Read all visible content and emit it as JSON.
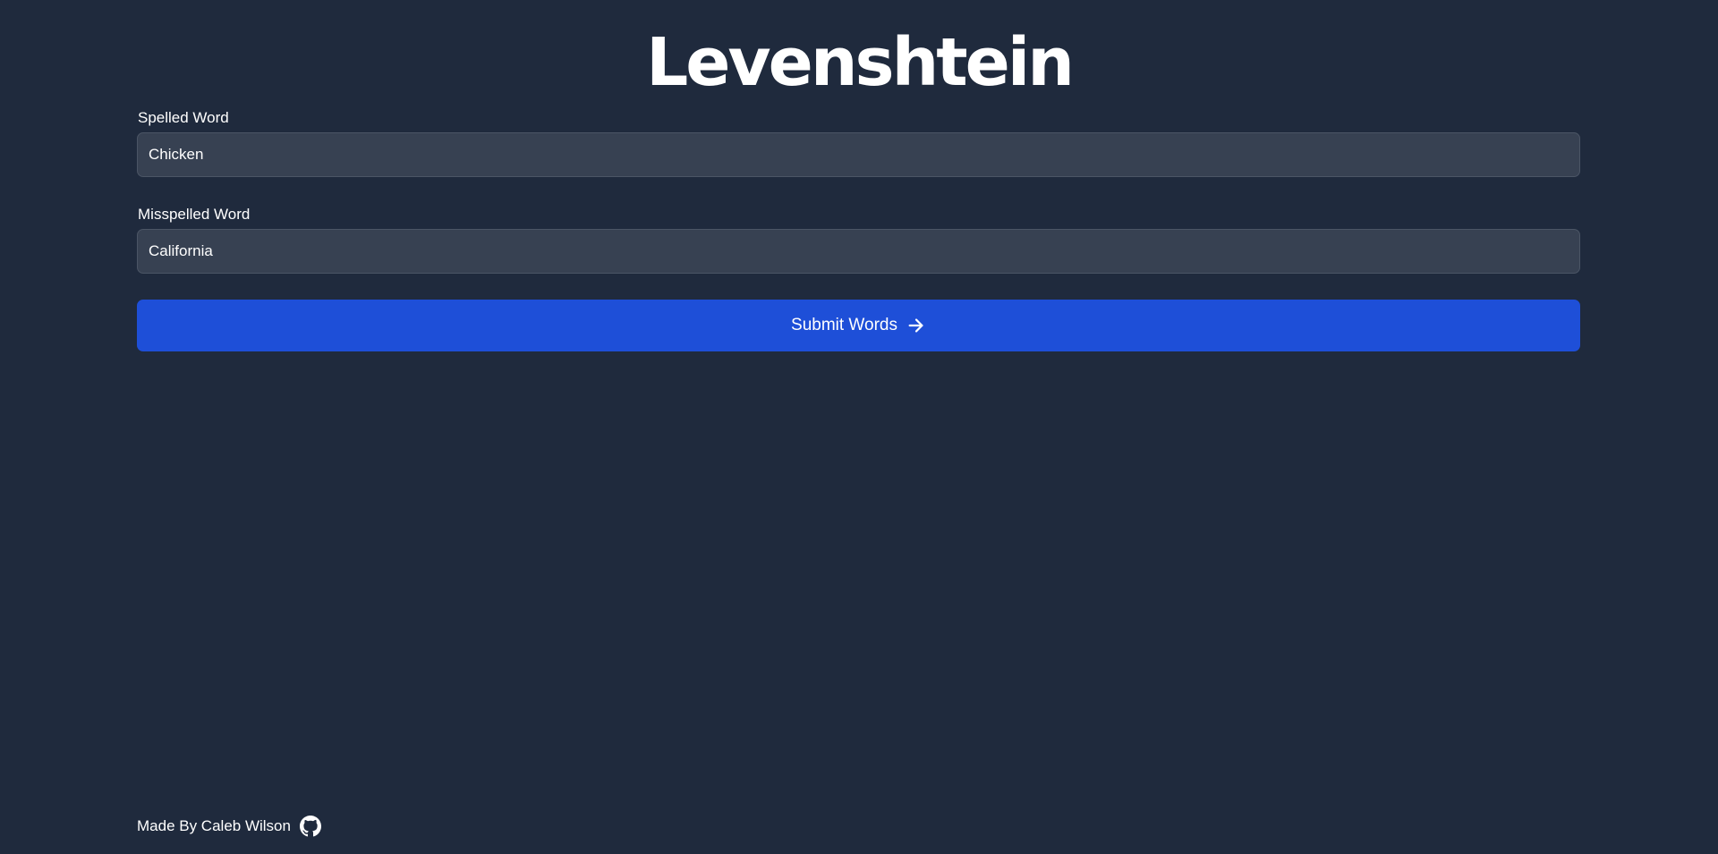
{
  "header": {
    "title": "Levenshtein"
  },
  "form": {
    "spelled": {
      "label": "Spelled Word",
      "value": "Chicken"
    },
    "misspelled": {
      "label": "Misspelled Word",
      "value": "California"
    },
    "submit_label": "Submit Words",
    "submit_icon": "arrow-right-icon"
  },
  "footer": {
    "credit": "Made By Caleb Wilson",
    "link_icon": "github-icon"
  },
  "colors": {
    "background": "#1f2a3d",
    "input_background": "#374152",
    "button_accent": "#1e4fd8",
    "text": "#ffffff"
  }
}
